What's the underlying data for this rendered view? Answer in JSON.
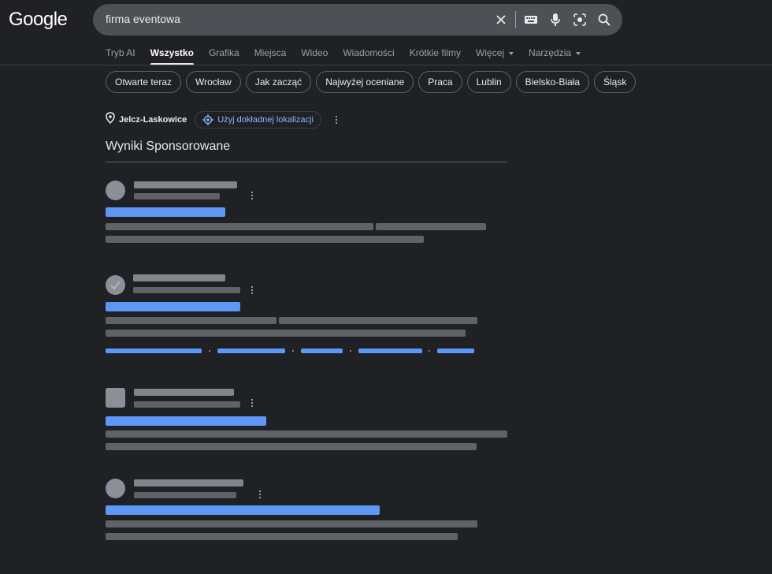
{
  "logo": "Google",
  "search": {
    "query": "firma eventowa",
    "icons": [
      "close-icon",
      "keyboard-icon",
      "mic-icon",
      "lens-icon",
      "search-icon"
    ]
  },
  "tabs": [
    {
      "label": "Tryb AI",
      "active": false
    },
    {
      "label": "Wszystko",
      "active": true
    },
    {
      "label": "Grafika",
      "active": false
    },
    {
      "label": "Miejsca",
      "active": false
    },
    {
      "label": "Wideo",
      "active": false
    },
    {
      "label": "Wiadomości",
      "active": false
    },
    {
      "label": "Krótkie filmy",
      "active": false
    },
    {
      "label": "Więcej",
      "active": false,
      "dropdown": true
    },
    {
      "label": "Narzędzia",
      "active": false,
      "dropdown": true
    }
  ],
  "chips": [
    "Otwarte teraz",
    "Wrocław",
    "Jak zacząć",
    "Najwyżej oceniane",
    "Praca",
    "Lublin",
    "Bielsko-Biała",
    "Śląsk"
  ],
  "location": {
    "name": "Jelcz-Laskowice",
    "precise_button": "Użyj dokładnej lokalizacji"
  },
  "section_title": "Wyniki Sponsorowane",
  "colors": {
    "background": "#1f2125",
    "link_blue": "#5e97f6",
    "placeholder": "#5f6368"
  }
}
